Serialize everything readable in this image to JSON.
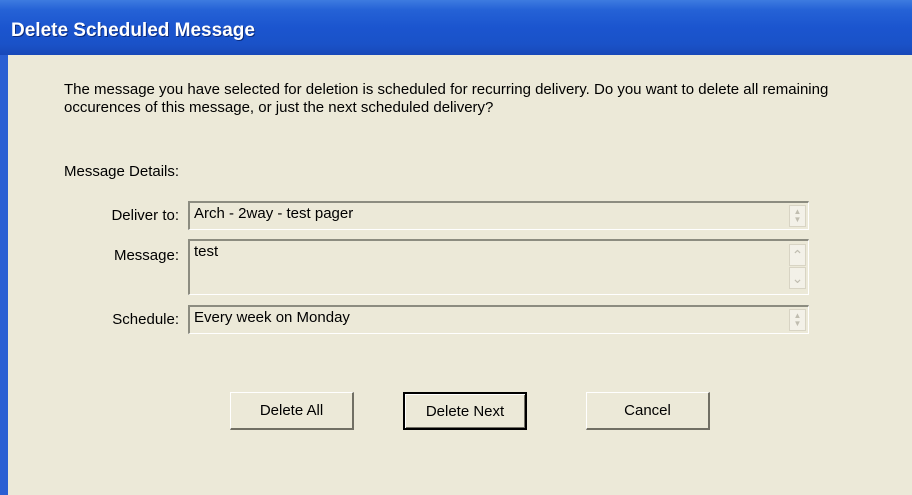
{
  "window": {
    "title": "Delete Scheduled Message"
  },
  "prompt": {
    "text": "The message you have selected for deletion is scheduled for recurring delivery.  Do you want to delete all remaining occurences of this message, or just the next scheduled delivery?"
  },
  "details": {
    "heading": "Message Details:",
    "deliver_to": {
      "label": "Deliver to:",
      "value": "Arch - 2way - test pager"
    },
    "message": {
      "label": "Message:",
      "value": "test"
    },
    "schedule": {
      "label": "Schedule:",
      "value": "Every week on  Monday"
    }
  },
  "buttons": {
    "delete_all": "Delete All",
    "delete_next": "Delete Next",
    "cancel": "Cancel"
  },
  "icons": {
    "spin_up": "▲",
    "spin_down": "▼",
    "scroll_up": "⌃",
    "scroll_down": "⌄"
  }
}
